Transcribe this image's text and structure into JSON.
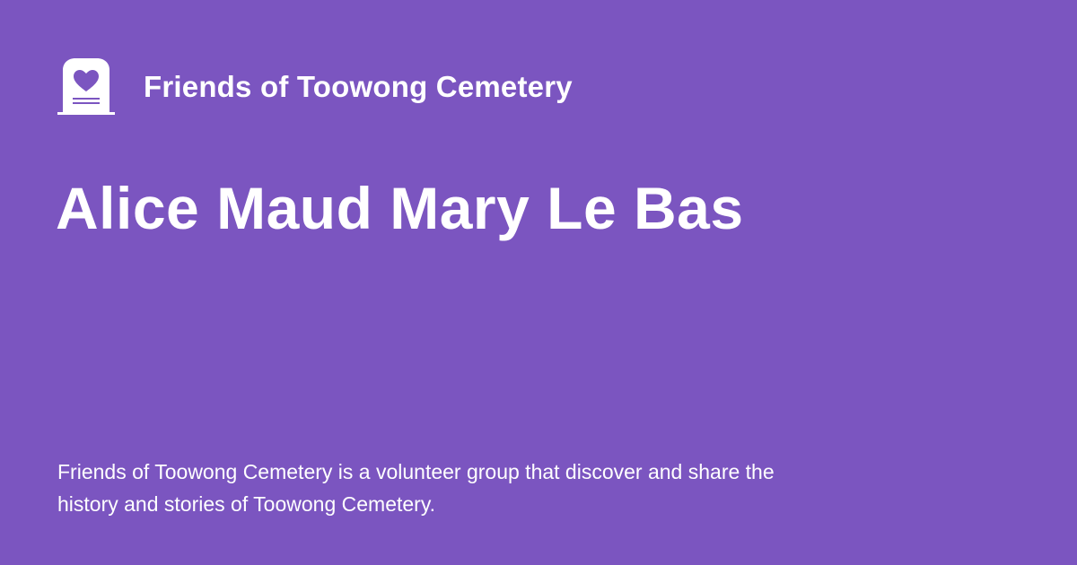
{
  "colors": {
    "background": "#7b55c0",
    "text": "#ffffff"
  },
  "header": {
    "logo_icon": "gravestone-heart-icon",
    "site_name": "Friends of Toowong Cemetery"
  },
  "main": {
    "title": "Alice Maud Mary Le Bas"
  },
  "footer": {
    "description": "Friends of Toowong Cemetery is a volunteer group that discover and share the history and stories of Toowong Cemetery."
  }
}
